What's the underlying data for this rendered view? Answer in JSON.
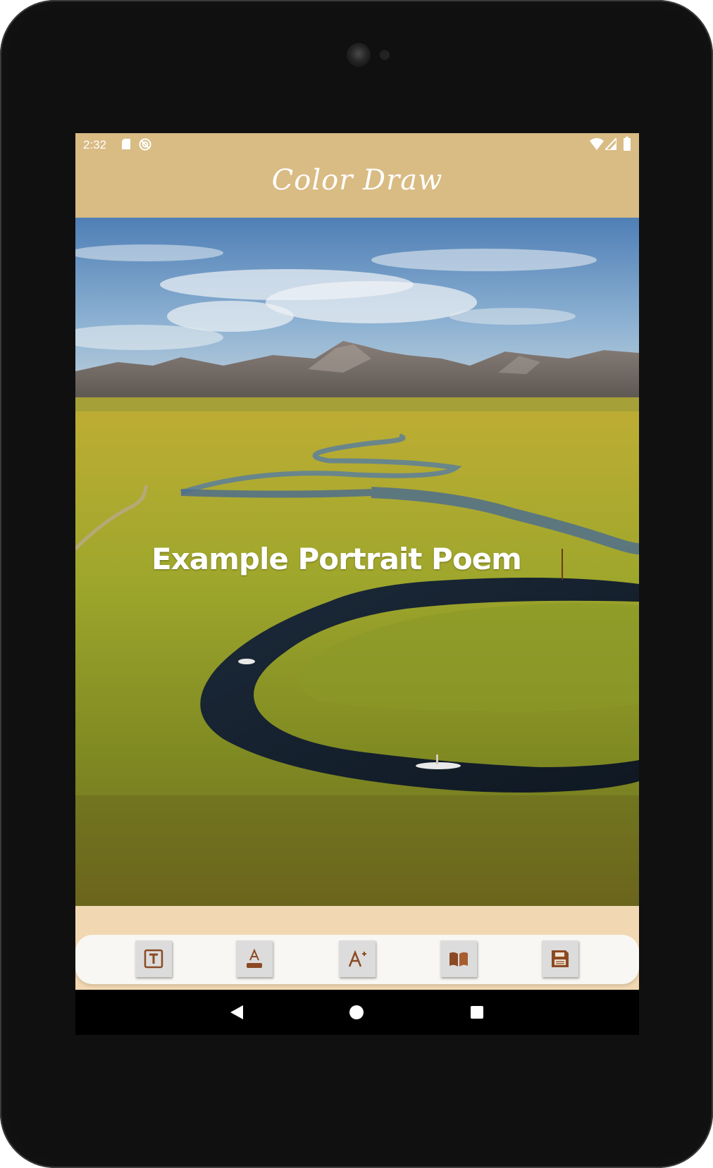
{
  "status_bar": {
    "time": "2:32",
    "icons": [
      "sd-card-icon",
      "sync-icon",
      "wifi-icon",
      "cell-signal-icon",
      "battery-icon"
    ]
  },
  "app_bar": {
    "title": "Color Draw"
  },
  "canvas": {
    "text": "Example Portrait Poem",
    "background": "landscape photo: winding river through green meadow, mountains, blue sky with clouds"
  },
  "toolbar": {
    "tools": [
      {
        "icon": "text-box-icon"
      },
      {
        "icon": "font-color-icon"
      },
      {
        "icon": "font-size-increase-icon"
      },
      {
        "icon": "open-book-icon"
      },
      {
        "icon": "save-icon"
      }
    ]
  },
  "nav_bar": {
    "icons": [
      "back-icon",
      "home-icon",
      "recent-apps-icon"
    ]
  },
  "colors": {
    "app_bar": "#d9bb84",
    "background": "#f2d8b2",
    "icon_brown": "#8b4a24",
    "toolbar_bg": "#f8f7f3"
  }
}
